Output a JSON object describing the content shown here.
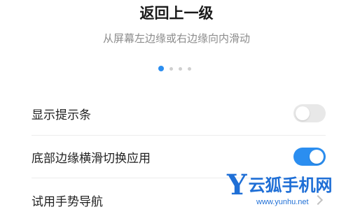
{
  "header": {
    "title": "返回上一级",
    "subtitle": "从屏幕左边缘或右边缘向内滑动"
  },
  "pager": {
    "count": 4,
    "active_index": 0
  },
  "settings": [
    {
      "label": "显示提示条",
      "control": "toggle",
      "state": "off"
    },
    {
      "label": "底部边缘横滑切换应用",
      "control": "toggle",
      "state": "on"
    },
    {
      "label": "试用手势导航",
      "control": "chevron-right-icon"
    }
  ],
  "watermark": {
    "text": "云狐手机网",
    "url": "www.yunhu.net"
  },
  "colors": {
    "accent": "#2b8ef0",
    "toggle_off": "#e8e8e8",
    "watermark": "#1f6fd6"
  }
}
